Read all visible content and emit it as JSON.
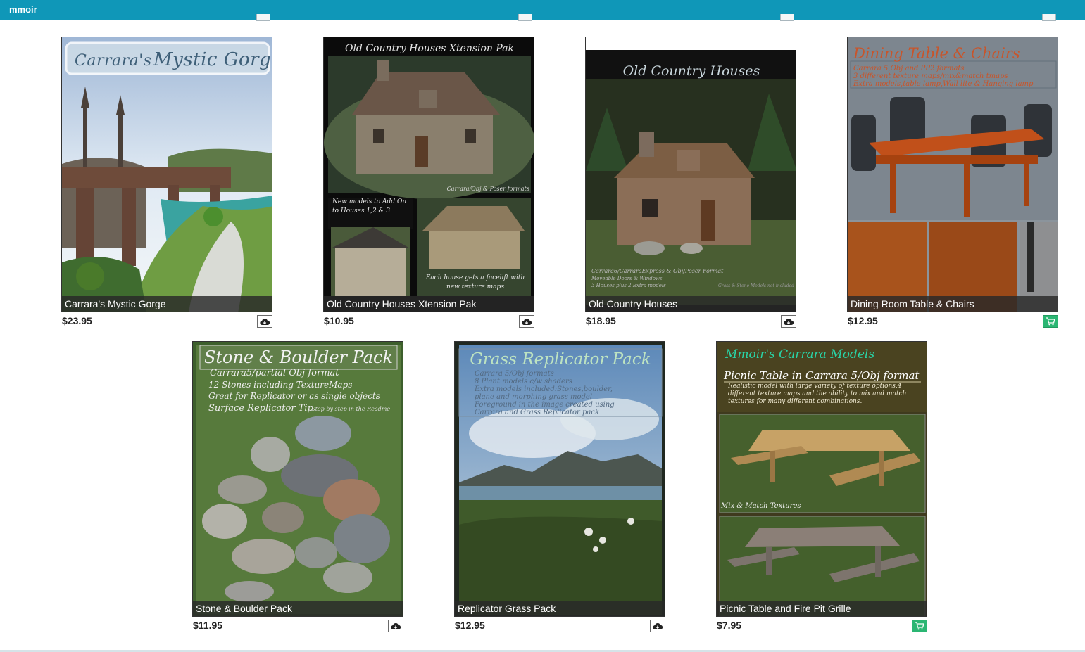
{
  "header": {
    "brand": "mmoir"
  },
  "products": [
    {
      "title": "Carrara's Mystic Gorge",
      "price": "$23.95",
      "action": "download",
      "cover": {
        "heading_a": "Carrara's",
        "heading_b": "Mystic Gorge"
      }
    },
    {
      "title": "Old Country Houses Xtension Pak",
      "price": "$10.95",
      "action": "download",
      "cover": {
        "heading": "Old Country Houses Xtension Pak",
        "formats": "Carrara/Obj & Poser formats",
        "note_left": "New models to Add On to Houses 1,2 & 3",
        "note_right": "Each house gets a facelift with new texture maps"
      }
    },
    {
      "title": "Old Country Houses",
      "price": "$18.95",
      "action": "download",
      "cover": {
        "heading": "Old Country Houses",
        "footer_1": "Carrara6/CarraraExpress & Obj/Poser Format",
        "footer_2": "Moveable Doors & Windows",
        "footer_3": "3 Houses plus 2 Extra models",
        "footer_right": "Grass & Stone Models not included"
      }
    },
    {
      "title": "Dining Room Table & Chairs",
      "price": "$12.95",
      "action": "cart",
      "cover": {
        "heading": "Dining Table & Chairs",
        "line_1": "Carrara 5,Obj and PP2 formats",
        "line_2": "3 different texture maps/mix&match tmaps",
        "line_3": "Extra models,table lamp,Wall lite & Hanging lamp"
      }
    },
    {
      "title": "Stone & Boulder Pack",
      "price": "$11.95",
      "action": "download",
      "cover": {
        "heading": "Stone & Boulder Pack",
        "line_1": "Carrara5/partial Obj format",
        "line_2": "12 Stones including TextureMaps",
        "line_3": "Great for Replicator or as single objects",
        "line_4": "Surface Replicator Tip",
        "line_4b": "/ Step by step in the Readme"
      }
    },
    {
      "title": "Replicator Grass Pack",
      "price": "$12.95",
      "action": "download",
      "cover": {
        "heading": "Grass Replicator Pack",
        "line_1": "Carrara 5/Obj formats",
        "line_2": "8 Plant models c/w shaders",
        "line_3": "Extra models included:Stones,boulder,",
        "line_4": "plane and morphing grass model",
        "line_5": "Foreground in the image created using",
        "line_6": "Carrara and Grass Replicator pack"
      }
    },
    {
      "title": "Picnic Table and Fire Pit Grille",
      "price": "$7.95",
      "action": "cart",
      "cover": {
        "brand": "Mmoir's Carrara Models",
        "heading": "Picnic Table in Carrara 5/Obj format",
        "desc": "Realistic model with large variety of texture options,4 different texture maps and the ability to mix and match textures for many different combinations.",
        "caption": "Mix & Match Textures"
      }
    }
  ],
  "colors": {
    "header_bg": "#0f97b8",
    "cart_green": "#2bb673",
    "title_bar": "#282828"
  },
  "icons": {
    "download": "cloud-download-icon",
    "cart": "shopping-cart-icon"
  }
}
